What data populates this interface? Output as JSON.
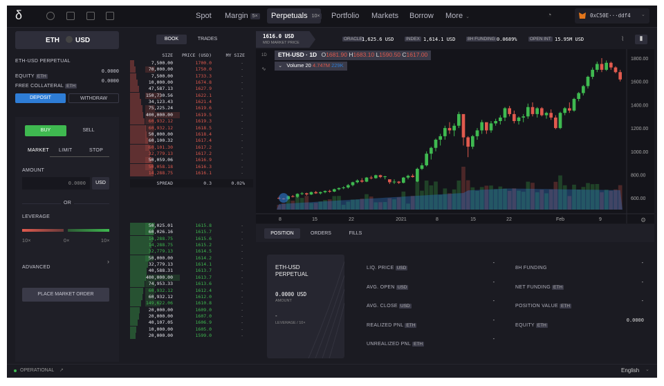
{
  "nav": {
    "logo": "δ",
    "links": [
      "Spot",
      "Margin",
      "Perpetuals",
      "Portfolio",
      "Markets",
      "Borrow",
      "More"
    ],
    "margin_badge": "5×",
    "perp_badge": "10×",
    "account": "0xC50E···ddf4"
  },
  "market": {
    "base": "ETH",
    "quote": "USD",
    "name": "ETH-USD PERPETUAL"
  },
  "balances": [
    {
      "label": "EQUITY",
      "asset": "ETH",
      "value": "0.0000"
    },
    {
      "label": "FREE COLLATERAL",
      "asset": "ETH",
      "value": "0.0000"
    }
  ],
  "buttons": {
    "deposit": "DEPOSIT",
    "withdraw": "WITHDRAW",
    "buy": "BUY",
    "sell": "SELL",
    "place": "PLACE MARKET ORDER"
  },
  "order_types": [
    "MARKET",
    "LIMIT",
    "STOP"
  ],
  "amount": {
    "label": "AMOUNT",
    "placeholder": "0.0000",
    "unit": "USD",
    "or": "OR"
  },
  "leverage": {
    "label": "LEVERAGE",
    "ticks": [
      "10×",
      "0×",
      "10×"
    ],
    "advanced": "ADVANCED"
  },
  "book": {
    "tabs": [
      "BOOK",
      "TRADES"
    ],
    "headers": [
      "SIZE",
      "PRICE (USD)",
      "MY SIZE"
    ],
    "asks": [
      [
        "7,500.00",
        "1700.0"
      ],
      [
        "70,000.00",
        "1750.0"
      ],
      [
        "7,500.00",
        "1733.3"
      ],
      [
        "10,000.00",
        "1674.8"
      ],
      [
        "47,587.13",
        "1627.9"
      ],
      [
        "150,730.56",
        "1622.1"
      ],
      [
        "34,123.43",
        "1621.4"
      ],
      [
        "75,225.24",
        "1619.6"
      ],
      [
        "400,000.00",
        "1619.5"
      ],
      [
        "60,932.12",
        "1619.3"
      ],
      [
        "60,932.12",
        "1618.5"
      ],
      [
        "50,000.00",
        "1618.4"
      ],
      [
        "60,100.32",
        "1617.4"
      ],
      [
        "60,101.30",
        "1617.2"
      ],
      [
        "32,779.13",
        "1617.2"
      ],
      [
        "50,059.06",
        "1616.9"
      ],
      [
        "50,058.18",
        "1616.3"
      ],
      [
        "14,288.75",
        "1616.1"
      ]
    ],
    "spread": {
      "label": "SPREAD",
      "value": "0.3",
      "pct": "0.02%"
    },
    "bids": [
      [
        "50,025.01",
        "1615.8"
      ],
      [
        "60,026.16",
        "1615.7"
      ],
      [
        "14,288.75",
        "1615.6"
      ],
      [
        "14,288.75",
        "1615.2"
      ],
      [
        "32,779.13",
        "1614.5"
      ],
      [
        "50,000.00",
        "1614.2"
      ],
      [
        "32,779.13",
        "1614.1"
      ],
      [
        "40,588.31",
        "1613.7"
      ],
      [
        "400,000.00",
        "1613.7"
      ],
      [
        "74,953.33",
        "1613.6"
      ],
      [
        "60,932.12",
        "1612.4"
      ],
      [
        "60,932.12",
        "1612.0"
      ],
      [
        "149,622.06",
        "1610.8"
      ],
      [
        "20,000.00",
        "1609.0"
      ],
      [
        "20,000.00",
        "1607.0"
      ],
      [
        "40,107.05",
        "1606.9"
      ],
      [
        "10,000.00",
        "1605.0"
      ],
      [
        "20,000.00",
        "1599.0"
      ]
    ],
    "my_size": "-"
  },
  "ticker": {
    "price": "1616.0 USD",
    "price_label": "MID MARKET PRICE",
    "oracle_label": "ORACLE",
    "oracle": "1,625.6 USD",
    "index_label": "INDEX",
    "index": "1,614.1 USD",
    "funding_label": "8H FUNDING",
    "funding": "0.0689%",
    "oi_label": "OPEN INT",
    "oi": "15.95M USD"
  },
  "chart_legend": {
    "symbol": "ETH-USD · 1D",
    "o": "1681.90",
    "h": "1683.10",
    "l": "1590.50",
    "c": "1617.00",
    "volume_label": "Volume 20",
    "volume": "4.747M",
    "volume2": "229K"
  },
  "chart_data": {
    "type": "candlestick",
    "interval": "1D",
    "ylim": [
      500,
      1830
    ],
    "yticks": [
      "1800.00",
      "1600.00",
      "1400.00",
      "1200.00",
      "1000.00",
      "800.00",
      "600.00"
    ],
    "xticks": [
      "8",
      "15",
      "22",
      "2021",
      "8",
      "15",
      "22",
      "Feb",
      "9"
    ],
    "candles": [
      [
        600,
        610,
        590,
        595
      ],
      [
        595,
        600,
        585,
        590
      ],
      [
        590,
        620,
        585,
        615
      ],
      [
        615,
        625,
        605,
        610
      ],
      [
        610,
        640,
        600,
        635
      ],
      [
        635,
        650,
        625,
        640
      ],
      [
        640,
        645,
        620,
        630
      ],
      [
        630,
        655,
        625,
        650
      ],
      [
        650,
        660,
        635,
        640
      ],
      [
        640,
        655,
        630,
        650
      ],
      [
        650,
        665,
        640,
        660
      ],
      [
        660,
        670,
        645,
        655
      ],
      [
        655,
        680,
        650,
        675
      ],
      [
        675,
        690,
        665,
        685
      ],
      [
        685,
        700,
        675,
        690
      ],
      [
        690,
        720,
        680,
        710
      ],
      [
        710,
        740,
        700,
        735
      ],
      [
        735,
        760,
        725,
        750
      ],
      [
        750,
        770,
        730,
        740
      ],
      [
        740,
        780,
        735,
        775
      ],
      [
        775,
        790,
        760,
        770
      ],
      [
        770,
        800,
        765,
        795
      ],
      [
        795,
        800,
        770,
        780
      ],
      [
        780,
        790,
        760,
        785
      ],
      [
        760,
        750,
        720,
        735
      ],
      [
        735,
        760,
        720,
        740
      ],
      [
        740,
        745,
        720,
        730
      ],
      [
        730,
        780,
        725,
        775
      ],
      [
        775,
        800,
        760,
        790
      ],
      [
        790,
        805,
        775,
        780
      ],
      [
        740,
        860,
        735,
        850
      ],
      [
        850,
        900,
        840,
        880
      ],
      [
        880,
        1000,
        870,
        980
      ],
      [
        980,
        1040,
        930,
        1030
      ],
      [
        1030,
        1110,
        1000,
        1100
      ],
      [
        1100,
        1150,
        1050,
        1130
      ],
      [
        1130,
        1220,
        1100,
        1200
      ],
      [
        1200,
        1250,
        1150,
        1180
      ],
      [
        1180,
        1240,
        1130,
        1220
      ],
      [
        1220,
        1340,
        1200,
        1320
      ],
      [
        1320,
        1200,
        1050,
        1120
      ],
      [
        1120,
        1130,
        950,
        1040
      ],
      [
        1040,
        1140,
        1020,
        1130
      ],
      [
        1130,
        1200,
        1100,
        1180
      ],
      [
        1180,
        1270,
        1150,
        1250
      ],
      [
        1250,
        1220,
        1150,
        1180
      ],
      [
        1180,
        1260,
        1160,
        1240
      ],
      [
        1240,
        1280,
        1220,
        1260
      ],
      [
        1260,
        1310,
        1230,
        1290
      ],
      [
        1290,
        1380,
        1260,
        1370
      ],
      [
        1370,
        1390,
        1300,
        1320
      ],
      [
        1320,
        1350,
        1240,
        1260
      ],
      [
        1260,
        1300,
        1230,
        1290
      ],
      [
        1290,
        1320,
        1250,
        1300
      ],
      [
        1300,
        1410,
        1280,
        1380
      ],
      [
        1380,
        1420,
        1300,
        1320
      ],
      [
        1320,
        1380,
        1290,
        1370
      ],
      [
        1370,
        1380,
        1300,
        1310
      ],
      [
        1310,
        1340,
        1280,
        1330
      ],
      [
        1330,
        1360,
        1270,
        1290
      ],
      [
        1290,
        1310,
        1190,
        1200
      ],
      [
        1200,
        1340,
        1190,
        1330
      ],
      [
        1330,
        1380,
        1310,
        1370
      ],
      [
        1370,
        1420,
        1330,
        1350
      ],
      [
        1350,
        1460,
        1340,
        1450
      ],
      [
        1450,
        1510,
        1430,
        1500
      ],
      [
        1500,
        1570,
        1480,
        1560
      ],
      [
        1560,
        1650,
        1540,
        1640
      ],
      [
        1640,
        1720,
        1620,
        1700
      ],
      [
        1700,
        1770,
        1680,
        1750
      ],
      [
        1750,
        1800,
        1680,
        1700
      ],
      [
        1700,
        1780,
        1690,
        1760
      ],
      [
        1760,
        1770,
        1700,
        1720
      ],
      [
        1720,
        1730,
        1670,
        1680
      ],
      [
        1680,
        1700,
        1600,
        1617
      ]
    ]
  },
  "bottom": {
    "tabs": [
      "POSITION",
      "ORDERS",
      "FILLS"
    ],
    "card": {
      "title": "ETH-USD PERPETUAL",
      "amount": "0.0000 USD",
      "amount_label": "AMOUNT",
      "dash": "-",
      "leverage": "LEVERAGE / 10×"
    },
    "left": [
      {
        "label": "LIQ. PRICE",
        "asset": "USD",
        "value": "-"
      },
      {
        "label": "AVG. OPEN",
        "asset": "USD",
        "value": "-"
      },
      {
        "label": "AVG. CLOSE",
        "asset": "USD",
        "value": "-"
      },
      {
        "label": "REALIZED PNL",
        "asset": "ETH",
        "value": "-"
      },
      {
        "label": "UNREALIZED PNL",
        "asset": "ETH",
        "value": "-"
      }
    ],
    "right": [
      {
        "label": "8H FUNDING",
        "asset": "",
        "value": "-"
      },
      {
        "label": "NET FUNDING",
        "asset": "ETH",
        "value": "-"
      },
      {
        "label": "POSITION VALUE",
        "asset": "ETH",
        "value": "-"
      },
      {
        "label": "EQUITY",
        "asset": "ETH",
        "value": "0.0000"
      }
    ]
  },
  "footer": {
    "status": "OPERATIONAL",
    "language": "English"
  },
  "colors": {
    "green": "#3fb950",
    "red": "#e05a4e",
    "accent": "#2e7dd6",
    "panel": "#1f1f27"
  }
}
